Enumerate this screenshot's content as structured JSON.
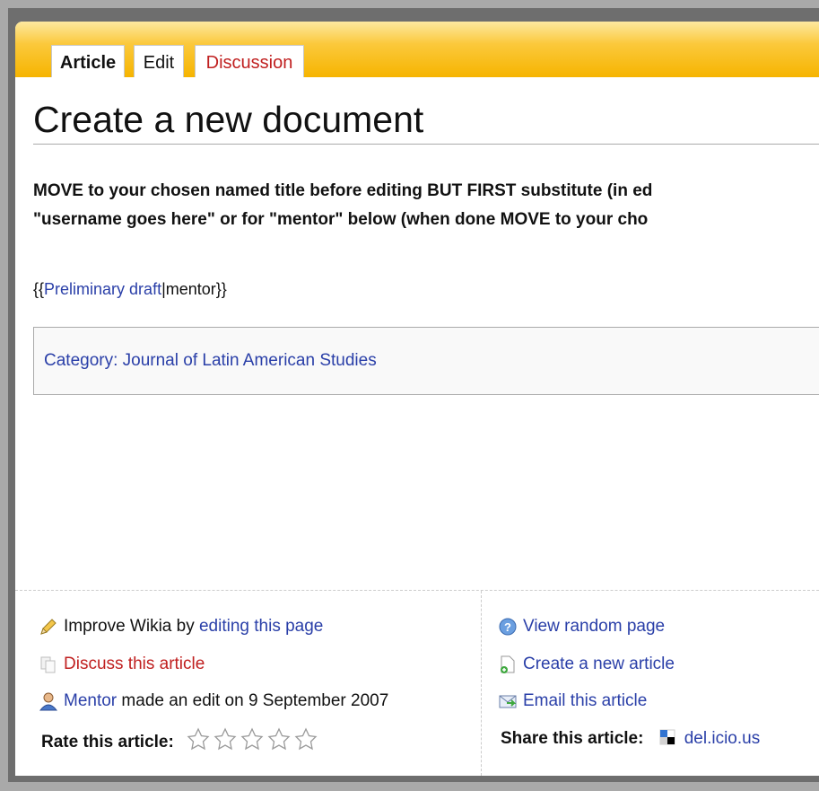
{
  "tabs": {
    "article": "Article",
    "edit": "Edit",
    "discussion": "Discussion"
  },
  "page_title": "Create a new document",
  "intro": {
    "line1": "MOVE to your chosen named title before editing BUT FIRST substitute (in ed",
    "line2": "\"username goes here\" or for \"mentor\" below (when done MOVE to your cho"
  },
  "template": {
    "open": "{{",
    "link": "Preliminary draft",
    "rest": "|mentor}}"
  },
  "category": "Category: Journal of Latin American Studies",
  "footer_left": {
    "improve_prefix": "Improve Wikia by ",
    "improve_link": "editing this page",
    "discuss": "Discuss this article",
    "editor_link": "Mentor",
    "editor_rest": " made an edit on 9 September 2007",
    "rate_label": "Rate this article:",
    "rating_stars": 0,
    "rating_max": 5
  },
  "footer_right": {
    "random": "View random page",
    "create": "Create a new article",
    "email": "Email this article",
    "share_label": "Share this article:",
    "share_link": "del.icio.us"
  },
  "icons": {
    "improve": "pencil-icon",
    "discuss": "discuss-icon",
    "editor": "user-icon",
    "random": "help-globe-icon",
    "create": "new-page-icon",
    "email": "email-icon",
    "share": "delicious-icon"
  }
}
